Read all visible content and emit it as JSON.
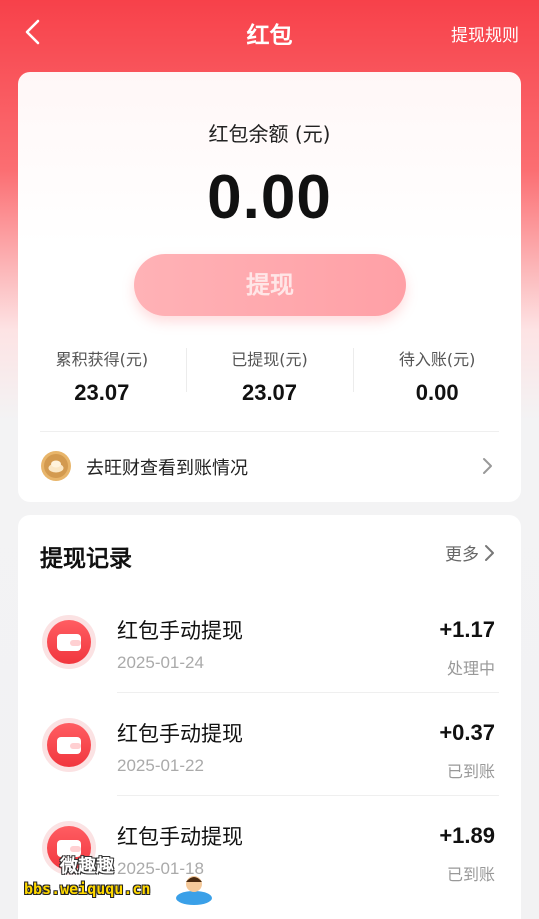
{
  "nav": {
    "title": "红包",
    "rules_label": "提现规则"
  },
  "balance": {
    "label": "红包余额 (元)",
    "amount": "0.00",
    "withdraw_label": "提现",
    "stats": [
      {
        "label": "累积获得(元)",
        "value": "23.07"
      },
      {
        "label": "已提现(元)",
        "value": "23.07"
      },
      {
        "label": "待入账(元)",
        "value": "0.00"
      }
    ],
    "wangcai_label": "去旺财查看到账情况"
  },
  "records": {
    "title": "提现记录",
    "more_label": "更多",
    "items": [
      {
        "name": "红包手动提现",
        "date": "2025-01-24",
        "amount": "+1.17",
        "status": "处理中"
      },
      {
        "name": "红包手动提现",
        "date": "2025-01-22",
        "amount": "+0.37",
        "status": "已到账"
      },
      {
        "name": "红包手动提现",
        "date": "2025-01-18",
        "amount": "+1.89",
        "status": "已到账"
      }
    ]
  },
  "watermark": {
    "line1": "微趣趣",
    "line2": "bbs.weiququ.cn"
  },
  "colors": {
    "brand_red": "#f7414a",
    "button_pink": "#ffa8ad",
    "coin_gold": "#d9a35a"
  },
  "icons": [
    "back-arrow-icon",
    "coin-icon",
    "chevron-right-icon",
    "wallet-icon"
  ]
}
